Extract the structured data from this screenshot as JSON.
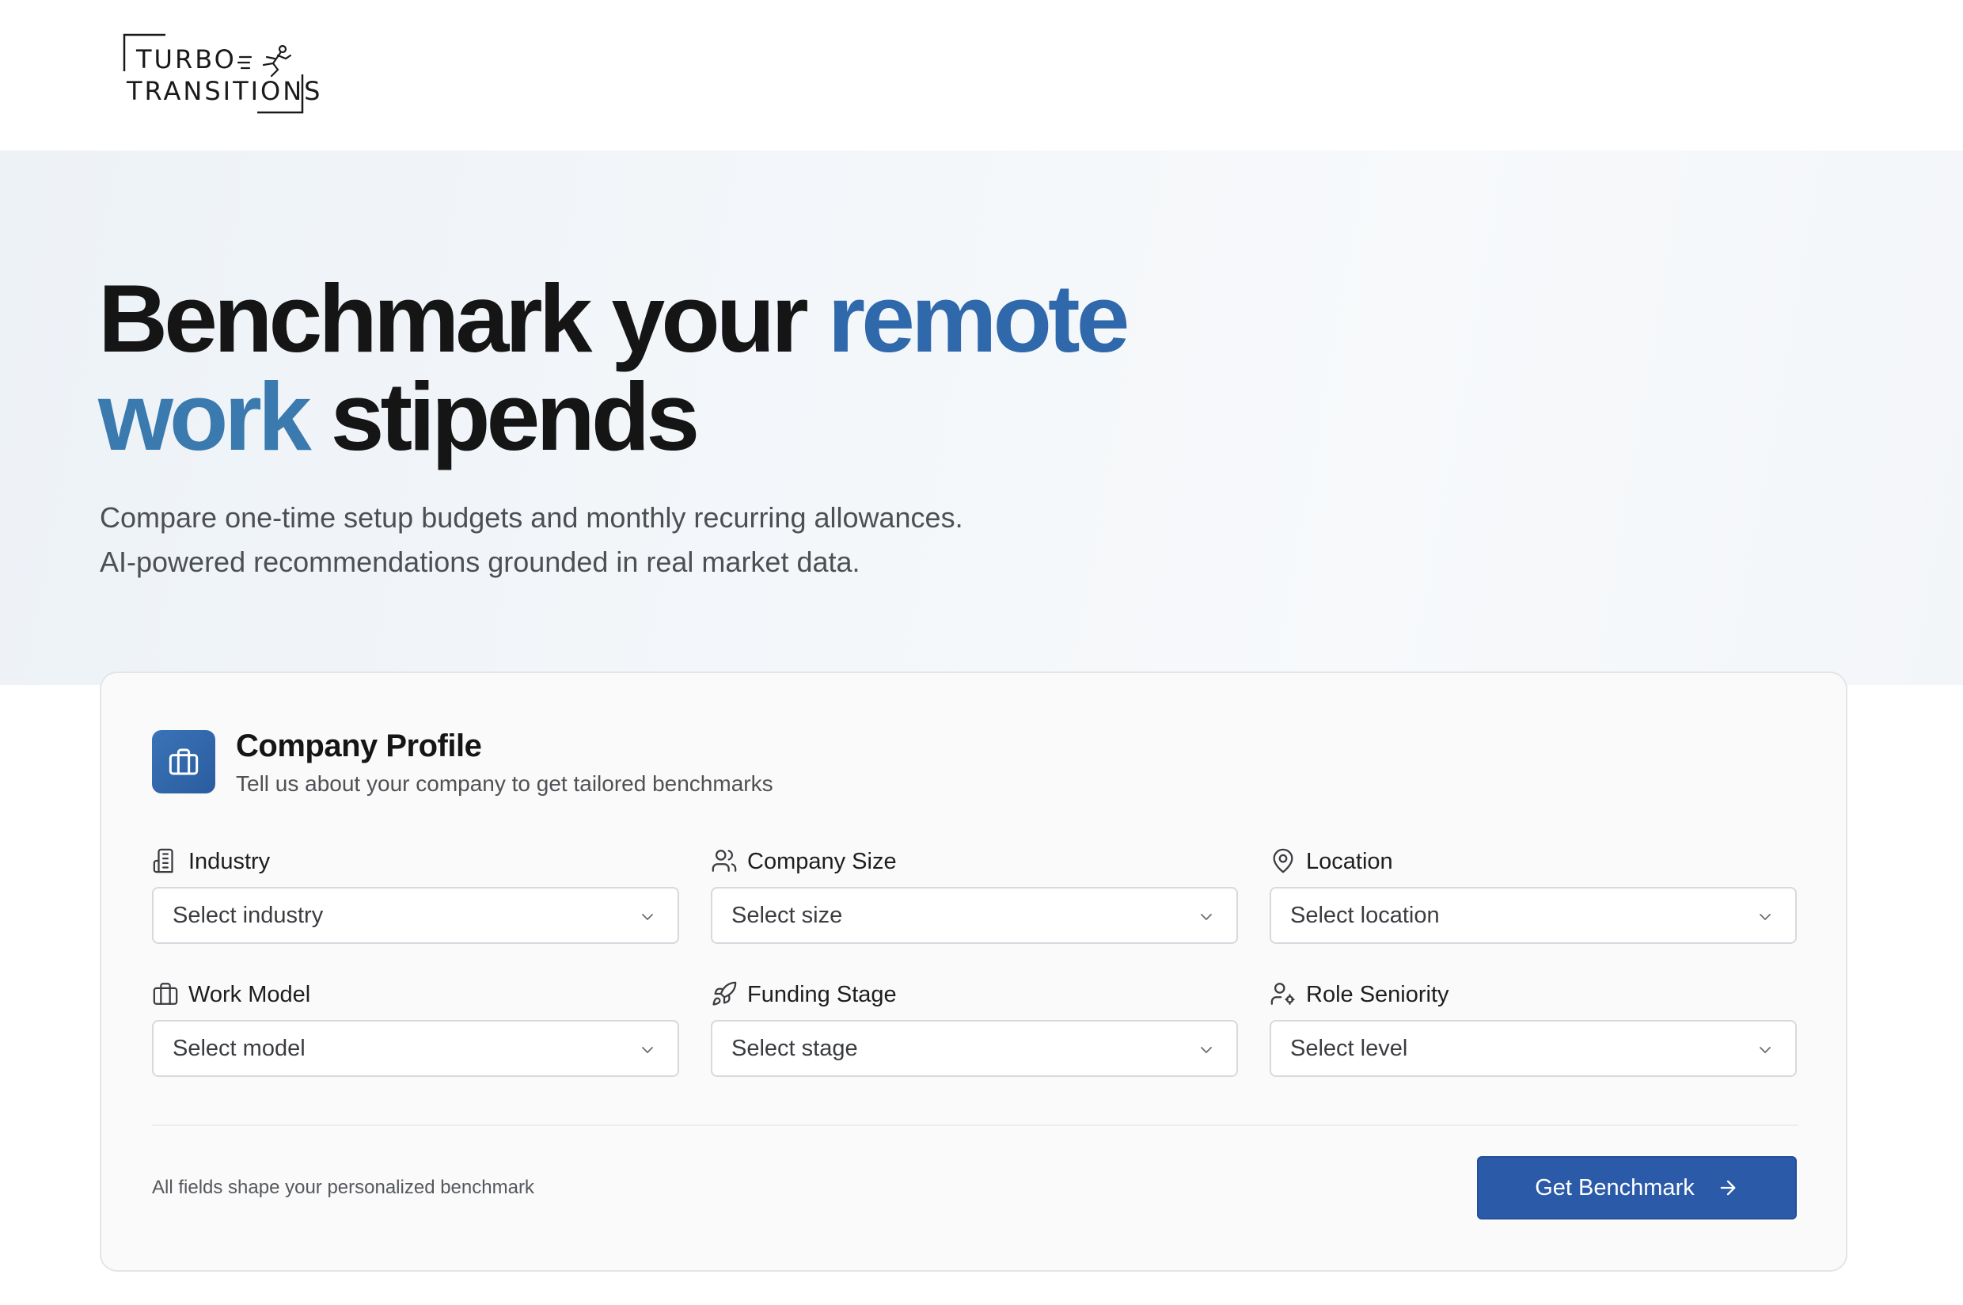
{
  "brand": {
    "line1": "TURBO",
    "line2": "TRANSITIONS"
  },
  "hero": {
    "title_part1": "Benchmark your ",
    "title_part2": "remote",
    "title_part3": "work",
    "title_part4": " stipends",
    "subtitle_line1": "Compare one-time setup budgets and monthly recurring allowances.",
    "subtitle_line2": "AI-powered recommendations grounded in real market data."
  },
  "card": {
    "icon": "briefcase-icon",
    "title": "Company Profile",
    "subtitle": "Tell us about your company to get tailored benchmarks",
    "fields": [
      {
        "icon": "building-icon",
        "label": "Industry",
        "placeholder": "Select industry"
      },
      {
        "icon": "users-icon",
        "label": "Company Size",
        "placeholder": "Select size"
      },
      {
        "icon": "map-pin-icon",
        "label": "Location",
        "placeholder": "Select location"
      },
      {
        "icon": "briefcase-icon",
        "label": "Work Model",
        "placeholder": "Select model"
      },
      {
        "icon": "rocket-icon",
        "label": "Funding Stage",
        "placeholder": "Select stage"
      },
      {
        "icon": "user-cog-icon",
        "label": "Role Seniority",
        "placeholder": "Select level"
      }
    ],
    "footnote": "All fields shape your personalized benchmark",
    "cta_label": "Get Benchmark",
    "cta_icon": "arrow-right-icon"
  },
  "colors": {
    "accent_blue": "#2f68ab",
    "accent_teal": "#3a7aae",
    "button": "#2a5aa8"
  }
}
